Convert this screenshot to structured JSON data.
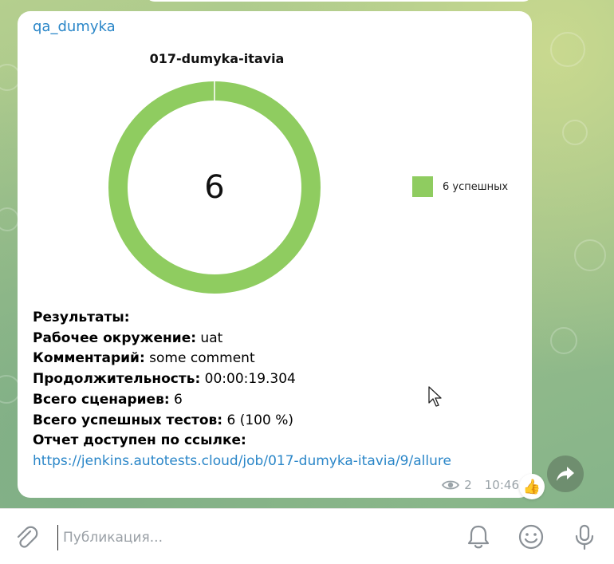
{
  "channel": {
    "author": "qa_dumyka"
  },
  "chart_data": {
    "type": "pie",
    "title": "017-dumyka-itavia",
    "center_label": "6",
    "categories": [
      "6 успешных"
    ],
    "values": [
      6
    ],
    "colors": [
      "#8fcc60"
    ],
    "legend_position": "right"
  },
  "report": {
    "rows": [
      {
        "label": "Результаты:",
        "value": ""
      },
      {
        "label": "Рабочее окружение:",
        "value": " uat"
      },
      {
        "label": "Комментарий:",
        "value": " some comment"
      },
      {
        "label": "Продолжительность:",
        "value": " 00:00:19.304"
      },
      {
        "label": "Всего сценариев:",
        "value": " 6"
      },
      {
        "label": "Всего успешных тестов:",
        "value": " 6 (100 %)"
      },
      {
        "label": "Отчет доступен по ссылке:",
        "value": ""
      }
    ],
    "link": "https://jenkins.autotests.cloud/job/017-dumyka-itavia/9/allure"
  },
  "message_meta": {
    "views": "2",
    "time": "10:46",
    "reaction": "👍"
  },
  "composer": {
    "placeholder": "Публикация..."
  },
  "colors": {
    "accent": "#2a86c8",
    "chart_green": "#8fcc60",
    "meta_gray": "#9aa3a8"
  }
}
